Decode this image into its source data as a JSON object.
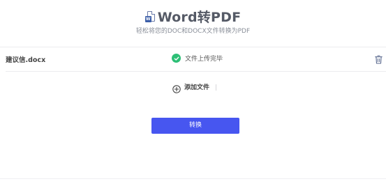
{
  "header": {
    "title": "Word转PDF",
    "subtitle": "轻松将您的DOC和DOCX文件转换为PDF",
    "icon": "word-file-icon",
    "icon_letter": "W"
  },
  "file_list": [
    {
      "name": "建议信.docx",
      "status": "文件上传完毕",
      "status_icon": "check-circle-icon",
      "action_icon": "trash-icon"
    }
  ],
  "add_file": {
    "label": "添加文件",
    "icon": "plus-circle-icon"
  },
  "convert_button": {
    "label": "转换",
    "color": "#4756f0"
  },
  "colors": {
    "success": "#2dbf76",
    "accent": "#4756f0",
    "title": "#555a66"
  }
}
